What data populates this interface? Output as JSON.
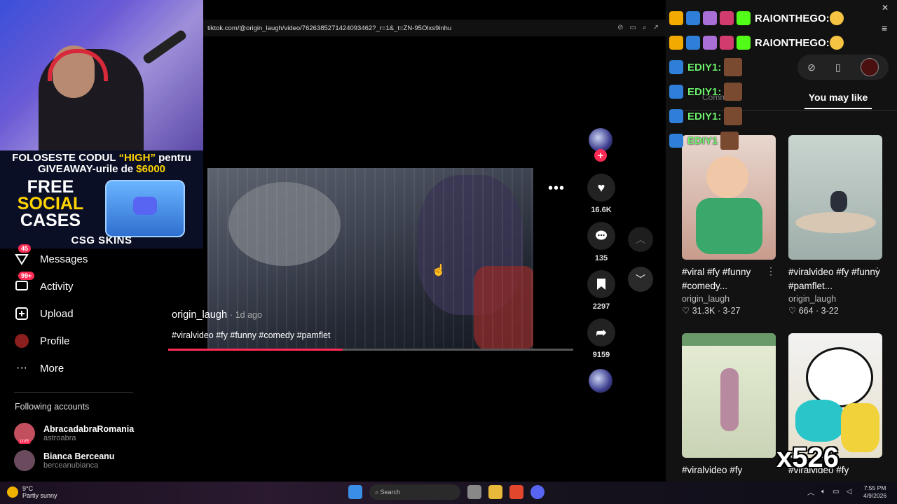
{
  "promo": {
    "line1_a": "FOLOSESTE CODUL ",
    "line1_code": "“HIGH”",
    "line1_b": " pentru",
    "line2_a": "GIVEAWAY-urile de ",
    "line2_amount": "$6000",
    "free1": "FREE",
    "free2": "SOCIAL",
    "free3": "CASES",
    "crate_label": "SKINS",
    "crate_sub": "Discord",
    "brand": "CSG SKINS"
  },
  "nav": {
    "messages": {
      "label": "Messages",
      "badge": "45"
    },
    "activity": {
      "label": "Activity",
      "badge": "99+"
    },
    "upload": {
      "label": "Upload"
    },
    "profile": {
      "label": "Profile"
    },
    "more": {
      "label": "More"
    }
  },
  "following": {
    "title": "Following accounts",
    "accounts": [
      {
        "name": "AbracadabraRomania",
        "handle": "astroabra",
        "badge": "LIVE"
      },
      {
        "name": "Bianca Berceanu",
        "handle": "berceanubianca"
      }
    ]
  },
  "browser": {
    "url": "tiktok.com/@origin_laugh/video/7626385271424093462?_r=1&_t=ZN-95Olxs9inhu"
  },
  "video": {
    "author": "origin_laugh",
    "ago": "1d ago",
    "tags": "#viralvideo #fy #funny #comedy #pamflet",
    "progress": 0.43,
    "likes": "16.6K",
    "comments": "135",
    "saves": "2297",
    "shares": "9159"
  },
  "chat": [
    {
      "name": "RAIONTHEGO:"
    },
    {
      "name": "RAIONTHEGO:"
    },
    {
      "name": "EDIY1:"
    },
    {
      "name": "EDIY1:"
    },
    {
      "name": "EDIY1:"
    },
    {
      "name": "EDIY1"
    }
  ],
  "right": {
    "tab_you_may_like": "You may like",
    "tab_comments": "Comm",
    "cards": [
      {
        "title": "#viral #fy #funny #comedy...",
        "author": "origin_laugh",
        "likes": "31.3K",
        "date": "3-27"
      },
      {
        "title": "#viralvideo #fy #funny #pamflet...",
        "author": "origin_laugh",
        "likes": "664",
        "date": "3-22"
      },
      {
        "title": "#viralvideo #fy"
      },
      {
        "title": "#viralvideo #fy"
      }
    ],
    "overlay_count": "x526"
  },
  "taskbar": {
    "temp": "9°C",
    "weather": "Partly sunny",
    "search": "Search",
    "time": "7:55 PM",
    "date": "4/9/2026"
  },
  "colors": {
    "accent": "#fe2c55",
    "promo_yellow": "#ffd400",
    "background": "#000000",
    "panel": "#121212"
  }
}
